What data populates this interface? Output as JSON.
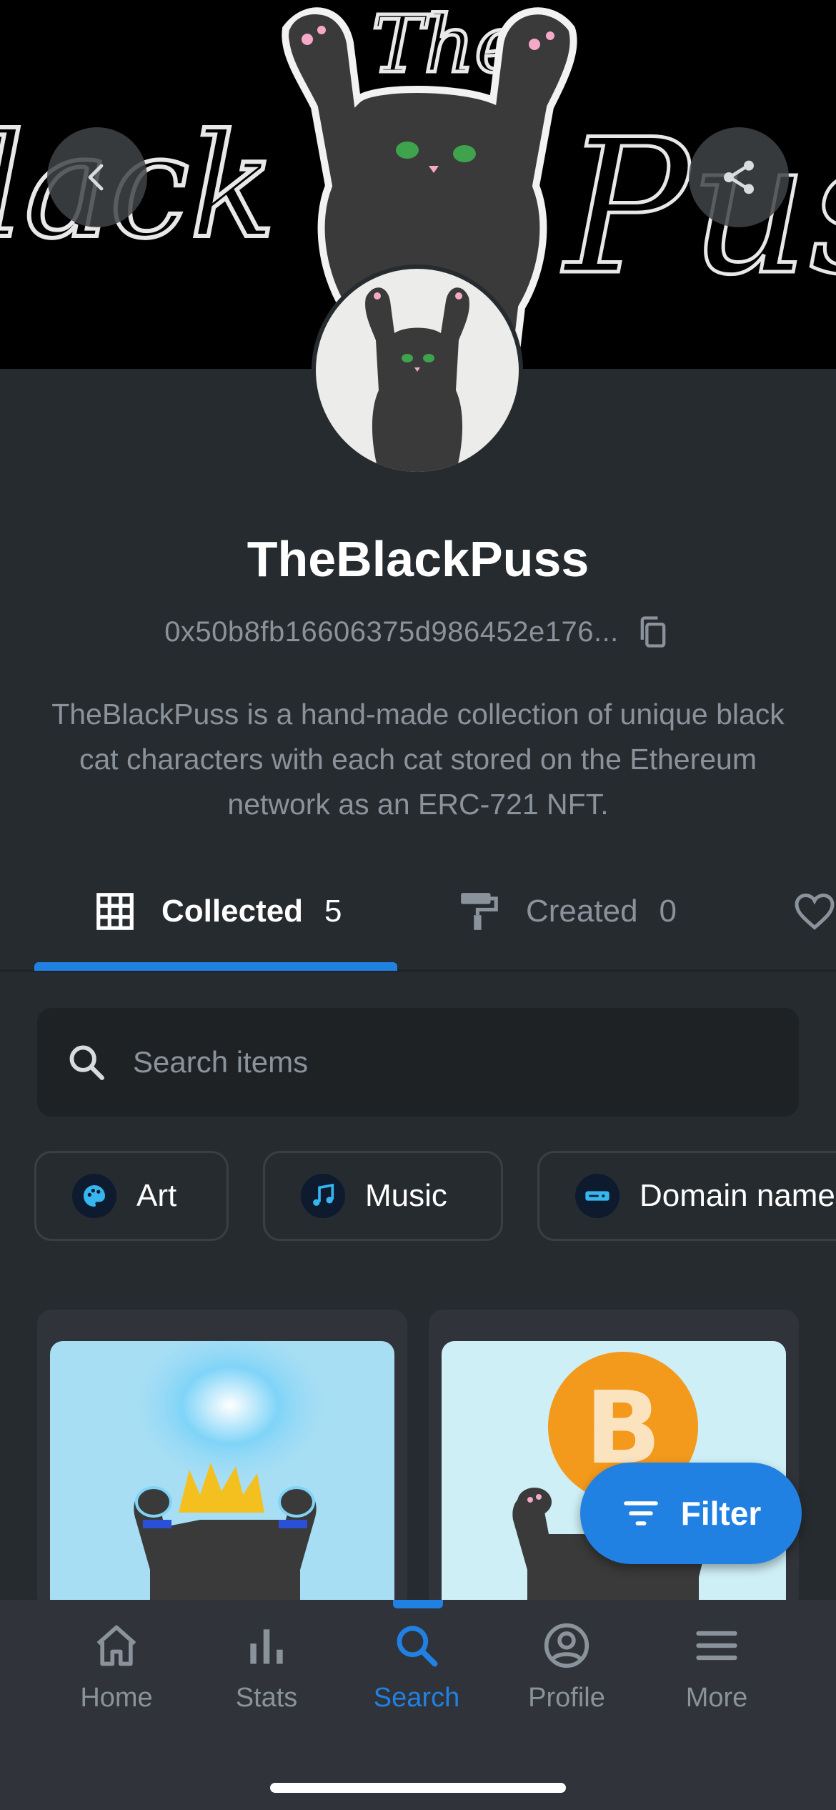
{
  "banner": {
    "title_art_text_left": "lack",
    "title_art_text_top": "The",
    "title_art_text_right": "Puss"
  },
  "header": {
    "back_icon": "chevron-left-icon",
    "share_icon": "share-icon"
  },
  "profile": {
    "name": "TheBlackPuss",
    "address": "0x50b8fb16606375d986452e176...",
    "copy_icon": "copy-icon",
    "bio": "TheBlackPuss is a hand-made collection of unique black cat characters with each cat stored on the Ethereum network as an ERC-721 NFT."
  },
  "tabs": [
    {
      "label": "Collected",
      "count": "5",
      "icon": "grid-icon",
      "active": true
    },
    {
      "label": "Created",
      "count": "0",
      "icon": "paint-roller-icon",
      "active": false
    },
    {
      "label": "",
      "count": "",
      "icon": "heart-icon",
      "active": false
    }
  ],
  "search": {
    "placeholder": "Search items",
    "value": ""
  },
  "chips": [
    {
      "label": "Art",
      "icon": "art-palette-icon"
    },
    {
      "label": "Music",
      "icon": "music-icon"
    },
    {
      "label": "Domain name",
      "icon": "domain-icon"
    }
  ],
  "filter_button": {
    "label": "Filter",
    "icon": "filter-icon"
  },
  "bottom_nav": [
    {
      "label": "Home",
      "icon": "home-icon",
      "active": false
    },
    {
      "label": "Stats",
      "icon": "stats-icon",
      "active": false
    },
    {
      "label": "Search",
      "icon": "search-icon",
      "active": true
    },
    {
      "label": "Profile",
      "icon": "profile-icon",
      "active": false
    },
    {
      "label": "More",
      "icon": "menu-icon",
      "active": false
    }
  ],
  "colors": {
    "accent": "#2081e2",
    "background": "#262b2f",
    "muted_text": "#8a939b"
  }
}
